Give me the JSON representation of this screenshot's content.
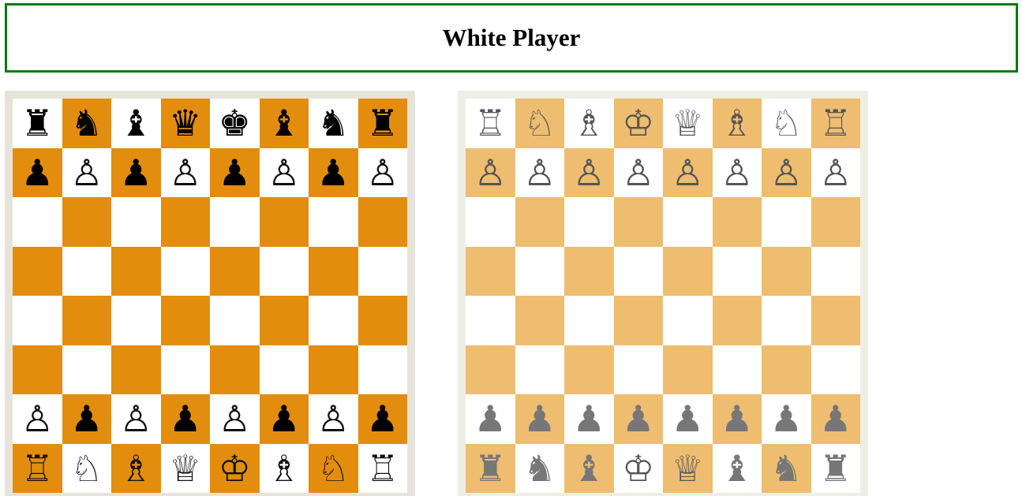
{
  "header": {
    "title": "White Player"
  },
  "colors": {
    "header_border": "#0a7a0a",
    "left_dark": "#e38d0f",
    "right_dark": "#eebd70",
    "light": "#ffffff"
  },
  "boards": [
    {
      "id": "left",
      "pieces": [
        [
          "♜",
          "♞",
          "♝",
          "♛",
          "♚",
          "♝",
          "♞",
          "♜"
        ],
        [
          "♟",
          "♙",
          "♟",
          "♙",
          "♟",
          "♙",
          "♟",
          "♙"
        ],
        [
          "",
          "",
          "",
          "",
          "",
          "",
          "",
          ""
        ],
        [
          "",
          "",
          "",
          "",
          "",
          "",
          "",
          ""
        ],
        [
          "",
          "",
          "",
          "",
          "",
          "",
          "",
          ""
        ],
        [
          "",
          "",
          "",
          "",
          "",
          "",
          "",
          ""
        ],
        [
          "♙",
          "♟",
          "♙",
          "♟",
          "♙",
          "♟",
          "♙",
          "♟"
        ],
        [
          "♖",
          "♘",
          "♗",
          "♕",
          "♔",
          "♗",
          "♘",
          "♖"
        ]
      ]
    },
    {
      "id": "right",
      "pieces": [
        [
          "♖",
          "♘",
          "♗",
          "♔",
          "♕",
          "♗",
          "♘",
          "♖"
        ],
        [
          "♙",
          "♙",
          "♙",
          "♙",
          "♙",
          "♙",
          "♙",
          "♙"
        ],
        [
          "",
          "",
          "",
          "",
          "",
          "",
          "",
          ""
        ],
        [
          "",
          "",
          "",
          "",
          "",
          "",
          "",
          ""
        ],
        [
          "",
          "",
          "",
          "",
          "",
          "",
          "",
          ""
        ],
        [
          "",
          "",
          "",
          "",
          "",
          "",
          "",
          ""
        ],
        [
          "♟",
          "♟",
          "♟",
          "♟",
          "♟",
          "♟",
          "♟",
          "♟"
        ],
        [
          "♜",
          "♞",
          "♝",
          "♔",
          "♕",
          "♝",
          "♞",
          "♜"
        ]
      ]
    }
  ]
}
